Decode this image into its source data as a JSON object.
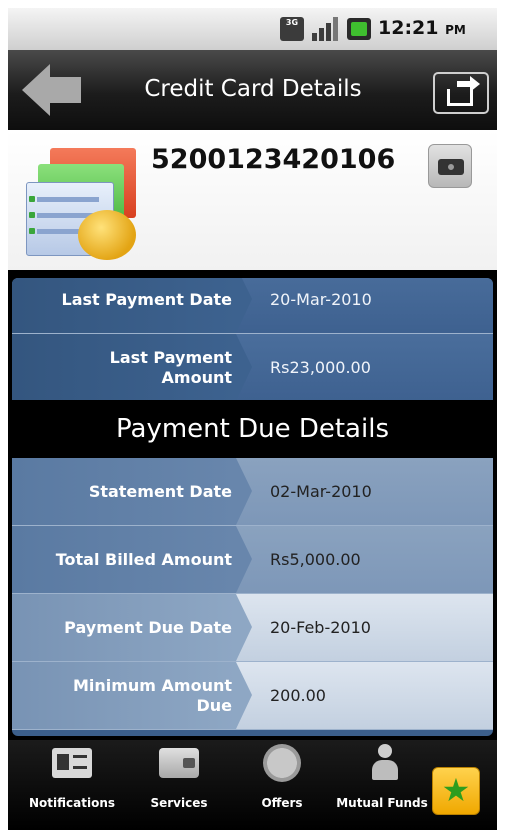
{
  "status_bar": {
    "network_icon": "3g-icon",
    "network_text": "3G",
    "signal_icon": "signal-icon",
    "battery_icon": "battery-icon",
    "time": "12:21",
    "ampm": "PM"
  },
  "header": {
    "title": "Credit Card Details",
    "back_icon": "back-arrow-icon",
    "share_icon": "share-icon"
  },
  "card": {
    "number": "5200123420106",
    "icon": "credit-card-piggy-bank-icon",
    "camera_icon": "camera-icon"
  },
  "details": {
    "rows_top": [
      {
        "label": "Last Payment Date",
        "value": "20-Mar-2010"
      },
      {
        "label": "Last Payment Amount",
        "value": "Rs23,000.00"
      }
    ],
    "section_title": "Payment Due Details",
    "rows_due": [
      {
        "label": "Statement Date",
        "value": "02-Mar-2010"
      },
      {
        "label": "Total Billed Amount",
        "value": "Rs5,000.00"
      },
      {
        "label": "Payment Due Date",
        "value": "20-Feb-2010"
      },
      {
        "label": "Minimum Amount Due",
        "value": "200.00"
      }
    ]
  },
  "bottom_nav": {
    "items": [
      {
        "label": "Notifications",
        "icon": "notifications-icon"
      },
      {
        "label": "Services",
        "icon": "wallet-icon"
      },
      {
        "label": "Offers",
        "icon": "offers-badge-icon"
      },
      {
        "label": "Mutual Funds",
        "icon": "mutual-funds-icon"
      }
    ],
    "favorite_icon": "star-icon"
  },
  "colors": {
    "accent_blue": "#3e6190",
    "favorite_yellow": "#f0a800",
    "star_green": "#2e9d1e"
  }
}
